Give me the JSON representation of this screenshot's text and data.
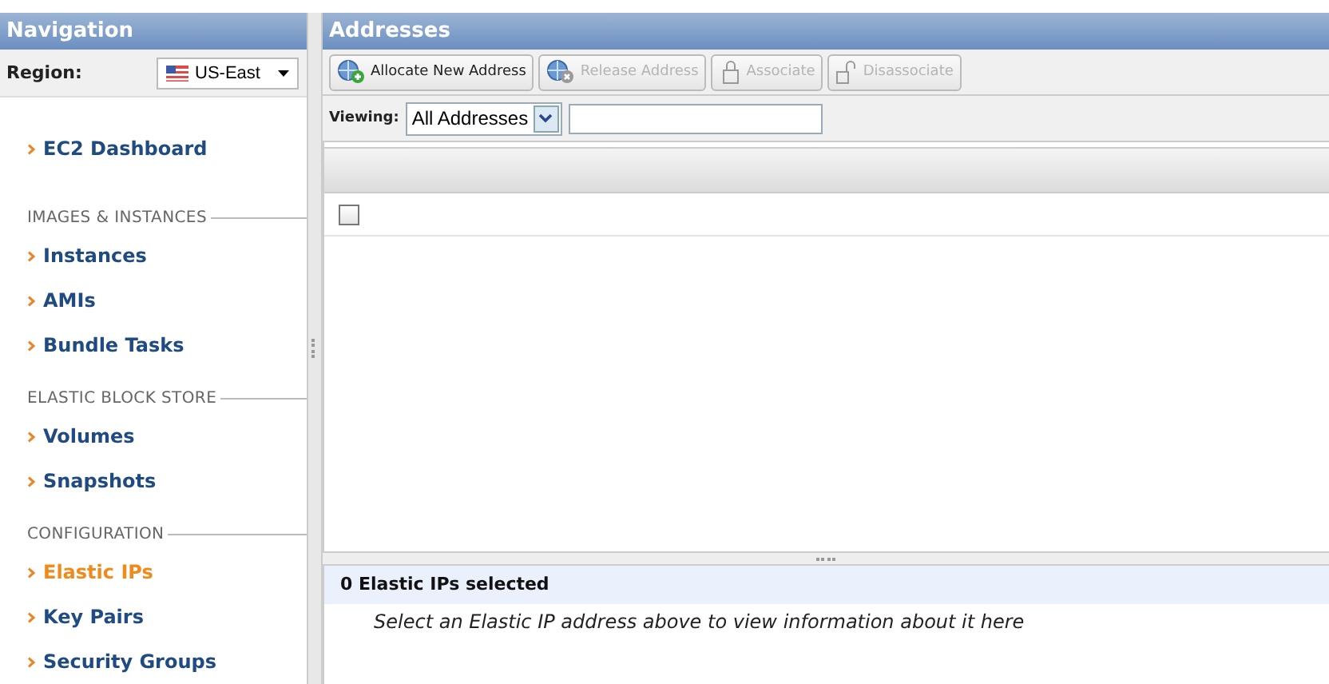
{
  "navigation": {
    "title": "Navigation",
    "region": {
      "label": "Region:",
      "value": "US-East"
    },
    "groups": [
      {
        "items": [
          {
            "label": "EC2 Dashboard",
            "selected": false
          }
        ]
      },
      {
        "heading": "IMAGES & INSTANCES",
        "items": [
          {
            "label": "Instances",
            "selected": false
          },
          {
            "label": "AMIs",
            "selected": false
          },
          {
            "label": "Bundle Tasks",
            "selected": false
          }
        ]
      },
      {
        "heading": "ELASTIC BLOCK STORE",
        "items": [
          {
            "label": "Volumes",
            "selected": false
          },
          {
            "label": "Snapshots",
            "selected": false
          }
        ]
      },
      {
        "heading": "CONFIGURATION",
        "items": [
          {
            "label": "Elastic IPs",
            "selected": true
          },
          {
            "label": "Key Pairs",
            "selected": false
          },
          {
            "label": "Security Groups",
            "selected": false
          }
        ]
      }
    ]
  },
  "addresses": {
    "title": "Addresses",
    "toolbar": [
      {
        "label": "Allocate New Address",
        "kind": "allocate",
        "disabled": false
      },
      {
        "label": "Release Address",
        "kind": "release",
        "disabled": true
      },
      {
        "label": "Associate",
        "kind": "associate",
        "disabled": true
      },
      {
        "label": "Disassociate",
        "kind": "disassociate",
        "disabled": true
      }
    ],
    "viewing": {
      "label": "Viewing:",
      "value": "All Addresses"
    },
    "table": {
      "select_all_checked": false
    }
  },
  "details": {
    "title": "0 Elastic IPs selected",
    "message": "Select an Elastic IP address above to view information about it here"
  }
}
